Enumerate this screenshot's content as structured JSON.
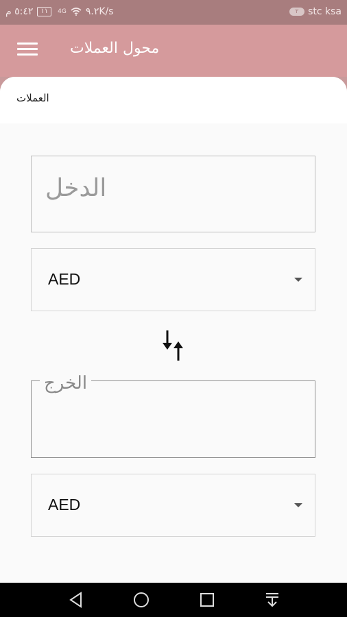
{
  "status": {
    "carrier": "stc ksa",
    "sim_slot": "٢",
    "speed": "٩.٢K/s",
    "network": "4G",
    "battery": "١١",
    "time": "٥:٤٢ م"
  },
  "app_bar": {
    "title": "محول العملات"
  },
  "section": {
    "label": "العملات"
  },
  "converter": {
    "input_placeholder": "الدخل",
    "from_currency": "AED",
    "output_label": "الخرج",
    "to_currency": "AED"
  },
  "colors": {
    "app_bar": "#d59a9c",
    "status_bar": "#a87d7e",
    "background": "#fafafa"
  },
  "icons": {
    "menu": "menu-icon",
    "swap": "swap-arrows-icon",
    "back": "back-triangle-icon",
    "home": "home-circle-icon",
    "recents": "recents-square-icon",
    "notifications": "pull-down-icon"
  }
}
